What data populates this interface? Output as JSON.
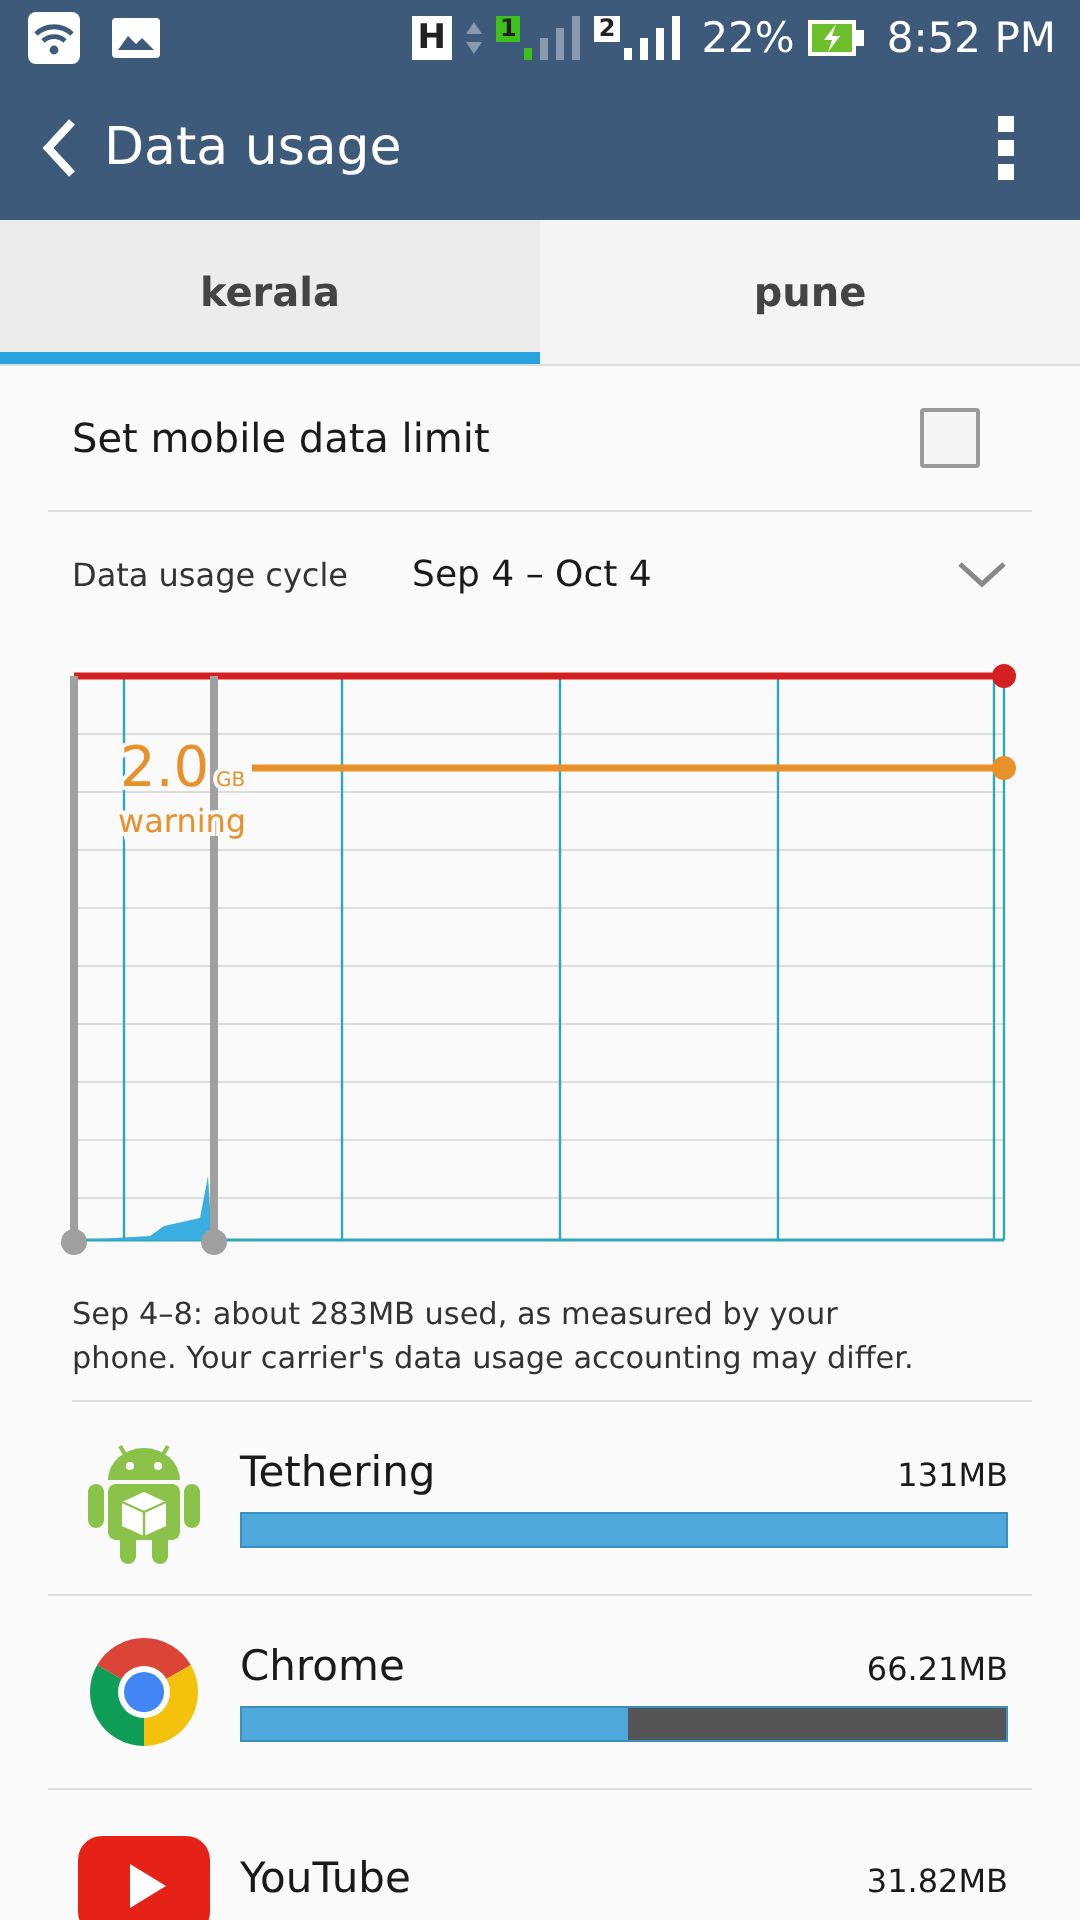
{
  "status_bar": {
    "network_badge": "H",
    "sim_1": "1",
    "sim_2": "2",
    "battery": "22%",
    "time": "8:52 PM"
  },
  "app_bar": {
    "title": "Data usage"
  },
  "tabs": [
    {
      "label": "kerala",
      "selected": true
    },
    {
      "label": "pune",
      "selected": false
    }
  ],
  "limit_row": {
    "label": "Set mobile data limit",
    "checked": false
  },
  "cycle": {
    "label": "Data usage cycle",
    "value": "Sep 4 – Oct 4"
  },
  "chart": {
    "warning_value": "2.0",
    "warning_unit": "GB",
    "warning_label": "warning"
  },
  "note": "Sep 4–8: about 283MB used, as measured by your phone. Your carrier's data usage accounting may differ.",
  "apps": [
    {
      "kind": "android",
      "name": "Tethering",
      "usage": "131MB",
      "level": 1.0
    },
    {
      "kind": "chrome",
      "name": "Chrome",
      "usage": "66.21MB",
      "level": 0.505
    },
    {
      "kind": "youtube",
      "name": "YouTube",
      "usage": "31.82MB"
    }
  ]
}
